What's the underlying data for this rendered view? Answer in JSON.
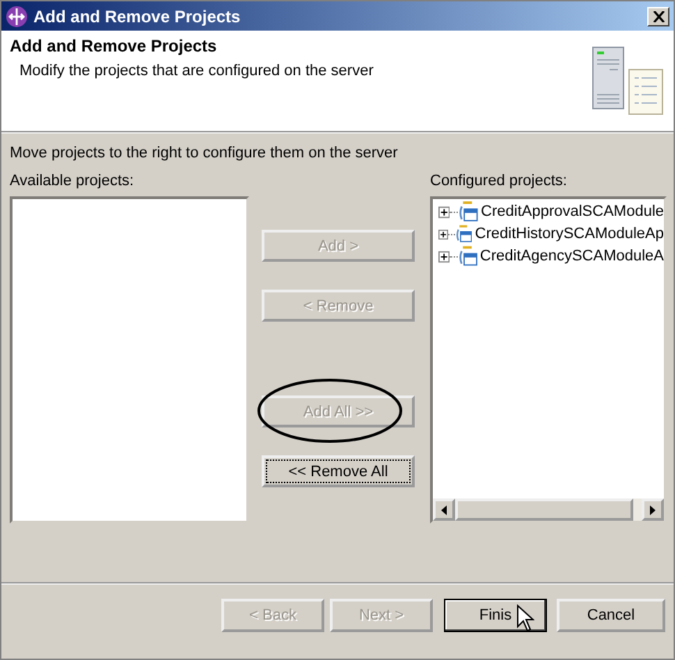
{
  "window": {
    "title": "Add and Remove Projects"
  },
  "header": {
    "title": "Add and Remove Projects",
    "description": "Modify the projects that are configured on the server"
  },
  "instruction": "Move projects to the right to configure them on the server",
  "available": {
    "label": "Available projects:"
  },
  "configured": {
    "label": "Configured projects:",
    "items": [
      {
        "name": "CreditApprovalSCAModule",
        "expanded": false
      },
      {
        "name": "CreditHistorySCAModuleAp",
        "expanded": false
      },
      {
        "name": "CreditAgencySCAModuleA",
        "expanded": false
      }
    ]
  },
  "move_buttons": [
    {
      "label": "Add >",
      "disabled": true,
      "focused": false,
      "circled": false
    },
    {
      "label": "< Remove",
      "disabled": true,
      "focused": false,
      "circled": false
    },
    {
      "label": "Add All >>",
      "disabled": true,
      "focused": false,
      "circled": true
    },
    {
      "label": "<< Remove All",
      "disabled": false,
      "focused": true,
      "circled": false
    }
  ],
  "footer_buttons": [
    {
      "label": "< Back",
      "disabled": true,
      "default": false,
      "pointer": false
    },
    {
      "label": "Next >",
      "disabled": true,
      "default": false,
      "pointer": false
    },
    {
      "label": "Finis",
      "disabled": false,
      "default": true,
      "pointer": true
    },
    {
      "label": "Cancel",
      "disabled": false,
      "default": false,
      "pointer": false
    }
  ]
}
